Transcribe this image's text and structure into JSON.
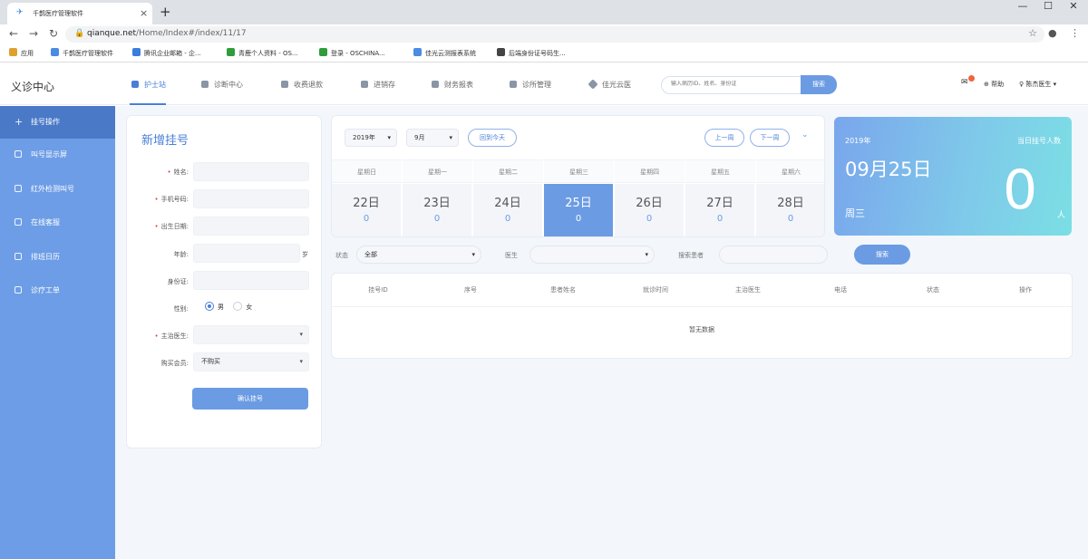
{
  "browser": {
    "tab_title": "千鹊医疗管理软件",
    "new_tab": "+",
    "url_host": "qianque.net",
    "url_path": "/Home/Index#/index/11/17",
    "bookmarks": [
      {
        "label": "应用",
        "color": "#e0a030"
      },
      {
        "label": "千鹊医疗管理软件",
        "color": "#4a8be3"
      },
      {
        "label": "腾讯企业邮箱 - 企...",
        "color": "#3b7ddd"
      },
      {
        "label": "青鹿个人资料 - OS...",
        "color": "#2e9d3a"
      },
      {
        "label": "登录 - OSCHINA...",
        "color": "#2e9d3a"
      },
      {
        "label": "佳光云测报表系统",
        "color": "#4a8be3"
      },
      {
        "label": "后端身份证号码生...",
        "color": "#444444"
      }
    ]
  },
  "header": {
    "app_title": "义诊中心",
    "menu": [
      {
        "label": "护士站",
        "active": true
      },
      {
        "label": "诊断中心"
      },
      {
        "label": "收费退款"
      },
      {
        "label": "进销存"
      },
      {
        "label": "财务报表"
      },
      {
        "label": "诊所管理"
      },
      {
        "label": "佳光云医"
      }
    ],
    "search_placeholder": "输入病历ID、姓名、身份证",
    "search_button": "搜索",
    "help": "帮助",
    "user": "陈杰医生"
  },
  "sidebar": {
    "items": [
      {
        "label": "挂号操作",
        "active": true
      },
      {
        "label": "叫号显示屏"
      },
      {
        "label": "红外检测叫号"
      },
      {
        "label": "在线客服"
      },
      {
        "label": "排班日历"
      },
      {
        "label": "诊疗工单"
      }
    ]
  },
  "register_form": {
    "title": "新增挂号",
    "fields": {
      "name": "姓名:",
      "phone": "手机号码:",
      "birthday": "出生日期:",
      "age": "年龄:",
      "age_unit": "岁",
      "id_card": "身份证:",
      "gender": "性别:",
      "gender_male": "男",
      "gender_female": "女",
      "doctor": "主治医生:",
      "membership": "购买会员:",
      "membership_value": "不购买"
    },
    "confirm_button": "确认挂号"
  },
  "calendar": {
    "year_select": "2019年",
    "month_select": "9月",
    "today_button": "回到今天",
    "prev_week": "上一周",
    "next_week": "下一周",
    "expand_icon": "double-chevron-down-icon",
    "weekdays": [
      "星期日",
      "星期一",
      "星期二",
      "星期三",
      "星期四",
      "星期五",
      "星期六"
    ],
    "days": [
      {
        "date": "22日",
        "count": "0"
      },
      {
        "date": "23日",
        "count": "0"
      },
      {
        "date": "24日",
        "count": "0"
      },
      {
        "date": "25日",
        "count": "0",
        "active": true
      },
      {
        "date": "26日",
        "count": "0"
      },
      {
        "date": "27日",
        "count": "0"
      },
      {
        "date": "28日",
        "count": "0"
      }
    ]
  },
  "stats_card": {
    "year": "2019年",
    "label": "当日挂号人数",
    "date": "09月25日",
    "weekday": "周三",
    "count": "0",
    "unit": "人"
  },
  "filter": {
    "status_label": "状态",
    "status_value": "全部",
    "doctor_label": "医生",
    "doctor_value": "",
    "patient_label": "搜索患者",
    "patient_value": "",
    "search_button": "搜索"
  },
  "table": {
    "columns": [
      "挂号ID",
      "序号",
      "患者姓名",
      "就诊时间",
      "主治医生",
      "电话",
      "状态",
      "操作"
    ],
    "empty_text": "暂无数据"
  },
  "colors": {
    "primary": "#6b9be3",
    "sidebar": "#6d9de6",
    "sidebar_active": "#4a79c8",
    "required": "#e04040",
    "notification": "#f0643c"
  }
}
